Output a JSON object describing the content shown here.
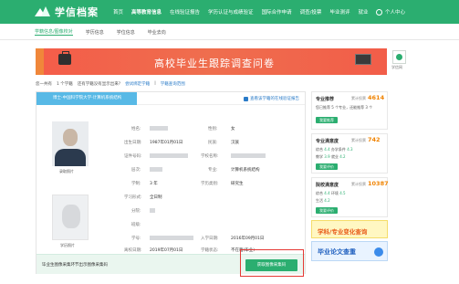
{
  "header": {
    "logo_text": "学信档案",
    "nav": [
      "首页",
      "高等教育信息",
      "在线验证报告",
      "学历认证与成绩验证",
      "国际合作申请",
      "调查/投票",
      "毕业测评",
      "就业"
    ],
    "user_label": "个人中心"
  },
  "subnav": [
    "学籍信息/图像校对",
    "学历信息",
    "学位信息",
    "毕业去向"
  ],
  "banner": {
    "title": "高校毕业生跟踪调查问卷"
  },
  "side_widget": {
    "label": "学信网"
  },
  "breadcrumb": {
    "prefix": "您一共有",
    "count_text": "1 个学籍",
    "text": "还有学籍没有显示出来?",
    "link1": "尝试绑定学籍",
    "link2": "学籍查询范围"
  },
  "tab": {
    "label": "博士-中国科学院大学-计算机系统结构",
    "right_link": "查看该学籍的在线验证报告"
  },
  "record": {
    "labels": {
      "name": "姓名:",
      "gender": "性别:",
      "birth": "出生日期:",
      "ethnicity": "民族:",
      "id_no": "证件号码:",
      "school": "学校名称:",
      "level": "层次:",
      "major": "专业:",
      "duration": "学制:",
      "edu_type": "学历类别:",
      "study_form": "学习形式:",
      "branch": "分院:",
      "class": "班级:",
      "student_no": "学号:",
      "enroll": "入学日期:",
      "status": "学籍状态:",
      "graduation": "离校日期:"
    },
    "values": {
      "gender": "女",
      "birth": "1987年01月01日",
      "ethnicity": "汉族",
      "major": "计算机系统结构",
      "duration": "3 年",
      "edu_type": "研究生",
      "study_form": "全日制",
      "enroll": "2016年09月01日",
      "graduation": "2019年07月01日",
      "status": "不在籍(毕业)"
    },
    "photo_label": "录取照片",
    "photo2_label": "学历照片"
  },
  "footer": {
    "text": "毕业生图像采集环节出示图像采集码",
    "button": "获取图像采集码"
  },
  "right": {
    "box1": {
      "title": "专业推荐",
      "count_label": "累计投票",
      "count": "4614",
      "line1": "您已推荐 5 个专业，还能推荐 3 个",
      "button": "我要推荐"
    },
    "box2": {
      "title": "专业满意度",
      "count_label": "累计投票",
      "count": "742",
      "line1_label": "综合",
      "line1_value": "4.4",
      "line1b_label": "办学条件",
      "line1b_value": "4.3",
      "line2_label": "教学",
      "line2_value": "3.9",
      "line2b_label": "就业",
      "line2b_value": "4.2",
      "button": "我要评价"
    },
    "box3": {
      "title": "院校满意度",
      "count_label": "累计投票",
      "count": "10387",
      "line1_label": "综合",
      "line1_value": "4.4",
      "line1b_label": "环境",
      "line1b_value": "4.5",
      "line2_label": "生活",
      "line2_value": "4.2",
      "button": "我要评价"
    },
    "promo1": "学科/专业变化查询",
    "promo2": "毕业论文查重"
  }
}
